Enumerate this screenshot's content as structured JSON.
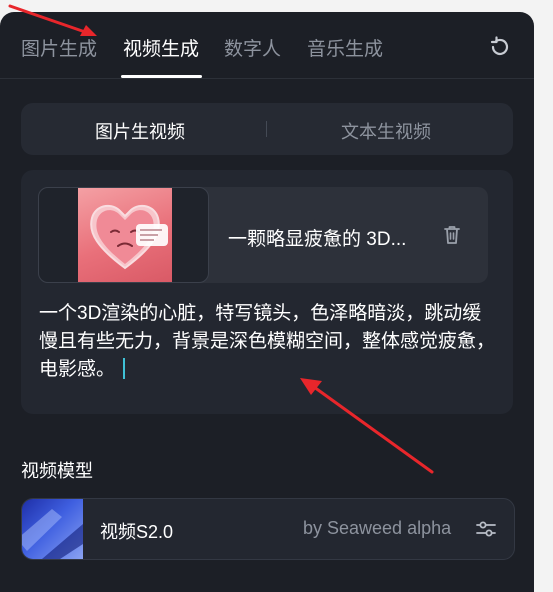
{
  "tabs": [
    {
      "label": "图片生成",
      "active": false
    },
    {
      "label": "视频生成",
      "active": true
    },
    {
      "label": "数字人",
      "active": false
    },
    {
      "label": "音乐生成",
      "active": false
    }
  ],
  "refresh_icon": "refresh-icon",
  "mode": {
    "active": "图片生视频",
    "inactive": "文本生视频"
  },
  "image_card": {
    "title": "一颗略显疲惫的 3D...",
    "thumbnail": "sad 3D heart with speech bubble"
  },
  "prompt_text": "一个3D渲染的心脏，特写镜头，色泽略暗淡，跳动缓慢且有些无力，背景是深色模糊空间，整体感觉疲惫，电影感。",
  "model_section": {
    "title": "视频模型",
    "name": "视频S2.0",
    "by": "by Seaweed alpha",
    "settings_icon": "sliders-icon"
  },
  "colors": {
    "panel_bg": "#1c1f26",
    "card_bg": "#232730",
    "text_primary": "#ffffff",
    "text_secondary": "#8d939e",
    "caret": "#3fc1d6",
    "annotation_arrow": "#e8262b"
  }
}
